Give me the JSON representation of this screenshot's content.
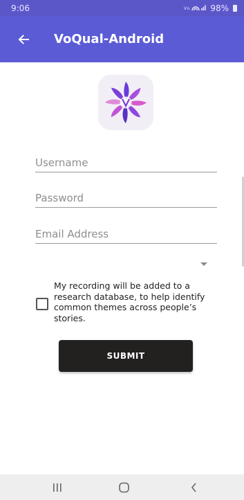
{
  "status_bar": {
    "time": "9:06",
    "icons": "VoLTE wifi signal",
    "battery": "98%"
  },
  "app_bar": {
    "title": "VoQual-Android",
    "back_icon": "arrow-left-icon",
    "color": "#5b5bd6"
  },
  "logo": {
    "icon": "voqual-logo-icon"
  },
  "form": {
    "username": {
      "placeholder": "Username",
      "value": ""
    },
    "password": {
      "placeholder": "Password",
      "value": ""
    },
    "email": {
      "placeholder": "Email Address",
      "value": ""
    },
    "dropdown": {
      "selected": ""
    },
    "consent": {
      "checked": false,
      "label": "My recording will be added to a research database, to help identify common themes across people’s stories."
    },
    "submit_label": "SUBMIT"
  },
  "nav_bar": {
    "recents_icon": "recents-icon",
    "home_icon": "home-icon",
    "back_icon": "chevron-left-icon"
  }
}
